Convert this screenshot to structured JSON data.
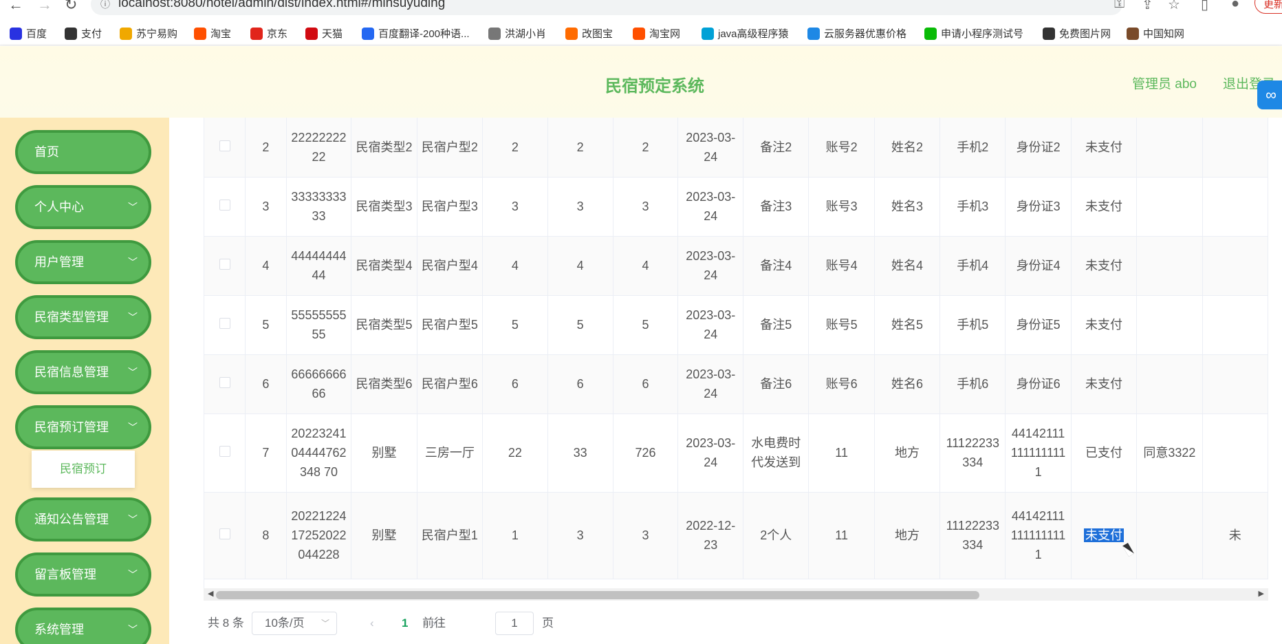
{
  "browser": {
    "url": "localhost:8080/hotel/admin/dist/index.html#/minsuyuding",
    "update_label": "更新",
    "bookmarks": [
      {
        "label": "百度",
        "color": "#2932e1"
      },
      {
        "label": "支付",
        "color": "#333333"
      },
      {
        "label": "苏宁易购",
        "color": "#f0a800"
      },
      {
        "label": "淘宝",
        "color": "#ff5000"
      },
      {
        "label": "京东",
        "color": "#e1251b"
      },
      {
        "label": "天猫",
        "color": "#d10a11"
      },
      {
        "label": "百度翻译-200种语...",
        "color": "#2468f2"
      },
      {
        "label": "洪湖小肖",
        "color": "#777777"
      },
      {
        "label": "改图宝",
        "color": "#ff6b00"
      },
      {
        "label": "淘宝网",
        "color": "#ff5000"
      },
      {
        "label": "java高级程序猿",
        "color": "#00a1d6"
      },
      {
        "label": "云服务器优惠价格",
        "color": "#1e88e5"
      },
      {
        "label": "申请小程序测试号",
        "color": "#09bb07"
      },
      {
        "label": "免费图片网",
        "color": "#333333"
      },
      {
        "label": "中国知网",
        "color": "#7a4b2a"
      }
    ]
  },
  "header": {
    "title": "民宿预定系统",
    "admin": "管理员 abo",
    "logout": "退出登录"
  },
  "sidebar": {
    "items": [
      {
        "label": "首页",
        "has_arrow": false
      },
      {
        "label": "个人中心",
        "has_arrow": true
      },
      {
        "label": "用户管理",
        "has_arrow": true
      },
      {
        "label": "民宿类型管理",
        "has_arrow": true
      },
      {
        "label": "民宿信息管理",
        "has_arrow": true
      },
      {
        "label": "民宿预订管理",
        "has_arrow": true
      },
      {
        "label": "通知公告管理",
        "has_arrow": true
      },
      {
        "label": "留言板管理",
        "has_arrow": true
      },
      {
        "label": "系统管理",
        "has_arrow": true
      }
    ],
    "submenu": {
      "label": "民宿预订"
    }
  },
  "table": {
    "rows": [
      {
        "idx": "2",
        "c1": "2222222222",
        "c2": "民宿类型2",
        "c3": "民宿户型2",
        "c4": "2",
        "c5": "2",
        "c6": "2",
        "c7": "2023-03-24",
        "c8": "备注2",
        "c9": "账号2",
        "c10": "姓名2",
        "c11": "手机2",
        "c12": "身份证2",
        "c13": "未支付",
        "c14": "",
        "c15": ""
      },
      {
        "idx": "3",
        "c1": "3333333333",
        "c2": "民宿类型3",
        "c3": "民宿户型3",
        "c4": "3",
        "c5": "3",
        "c6": "3",
        "c7": "2023-03-24",
        "c8": "备注3",
        "c9": "账号3",
        "c10": "姓名3",
        "c11": "手机3",
        "c12": "身份证3",
        "c13": "未支付",
        "c14": "",
        "c15": ""
      },
      {
        "idx": "4",
        "c1": "4444444444",
        "c2": "民宿类型4",
        "c3": "民宿户型4",
        "c4": "4",
        "c5": "4",
        "c6": "4",
        "c7": "2023-03-24",
        "c8": "备注4",
        "c9": "账号4",
        "c10": "姓名4",
        "c11": "手机4",
        "c12": "身份证4",
        "c13": "未支付",
        "c14": "",
        "c15": ""
      },
      {
        "idx": "5",
        "c1": "5555555555",
        "c2": "民宿类型5",
        "c3": "民宿户型5",
        "c4": "5",
        "c5": "5",
        "c6": "5",
        "c7": "2023-03-24",
        "c8": "备注5",
        "c9": "账号5",
        "c10": "姓名5",
        "c11": "手机5",
        "c12": "身份证5",
        "c13": "未支付",
        "c14": "",
        "c15": ""
      },
      {
        "idx": "6",
        "c1": "6666666666",
        "c2": "民宿类型6",
        "c3": "民宿户型6",
        "c4": "6",
        "c5": "6",
        "c6": "6",
        "c7": "2023-03-24",
        "c8": "备注6",
        "c9": "账号6",
        "c10": "姓名6",
        "c11": "手机6",
        "c12": "身份证6",
        "c13": "未支付",
        "c14": "",
        "c15": ""
      },
      {
        "idx": "7",
        "c1": "2022324104444762348 70",
        "c2": "别墅",
        "c3": "三房一厅",
        "c4": "22",
        "c5": "33",
        "c6": "726",
        "c7": "2023-03-24",
        "c8": "水电费时代发送到",
        "c9": "11",
        "c10": "地方",
        "c11": "11122233334",
        "c12": "441421111111111111",
        "c13": "已支付",
        "c14": "同意3322",
        "c15": ""
      },
      {
        "idx": "8",
        "c1": "2022122417252022044228",
        "c2": "别墅",
        "c3": "民宿户型1",
        "c4": "1",
        "c5": "3",
        "c6": "3",
        "c7": "2022-12-23",
        "c8": "2个人",
        "c9": "11",
        "c10": "地方",
        "c11": "11122233334",
        "c12": "441421111111111111",
        "c13": "未支付",
        "c14": "",
        "c15": "未"
      }
    ]
  },
  "pager": {
    "total": "共 8 条",
    "page_size": "10条/页",
    "prev": "‹",
    "current": "1",
    "next": "›",
    "goto_label": "前往",
    "goto_value": "1",
    "page_suffix": "页"
  }
}
